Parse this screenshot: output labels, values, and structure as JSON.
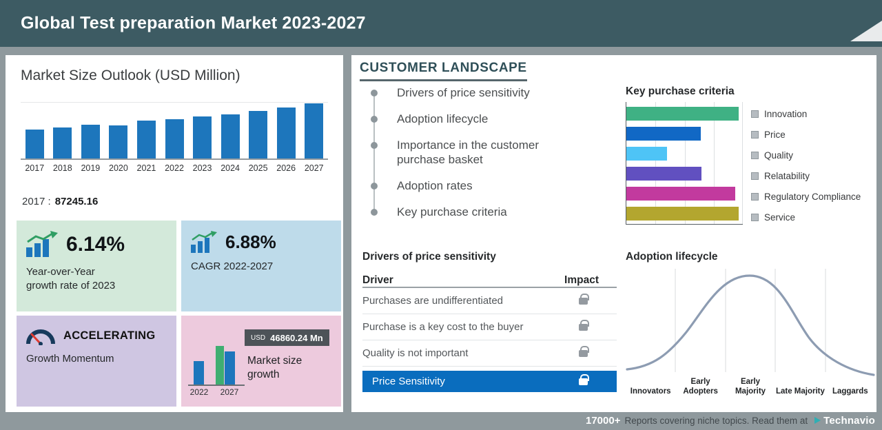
{
  "header": {
    "title": "Global Test preparation Market 2023-2027"
  },
  "colors": {
    "header_bg": "#3d5b63",
    "page_bg": "#8f999d",
    "bar_blue": "#1d76bc",
    "highlight_blue": "#0a6dbe",
    "yoy_card_bg": "#d3e9da",
    "cagr_card_bg": "#bedbea",
    "momentum_card_bg": "#cfc6e2",
    "growth_card_bg": "#edcadd",
    "curve": "#8d9cb2"
  },
  "icons": {
    "growth-chart-icon": "bar-chart-with-up-arrow",
    "cagr-chart-icon": "bar-chart-with-up-arrow",
    "speedometer-icon": "gauge-accelerating",
    "lock-icon": "padlock",
    "bullet-icon": "dot",
    "brand-mark-icon": "triangle-right"
  },
  "market_size": {
    "base_label": "2017 :",
    "base_value": "87245.16",
    "yoy_card": {
      "value": "6.14%",
      "line1": "Year-over-Year",
      "line2": "growth rate of 2023"
    },
    "cagr_card": {
      "value": "6.88%",
      "label": "CAGR 2022-2027"
    },
    "momentum_card": {
      "value": "ACCELERATING",
      "label": "Growth Momentum"
    },
    "growth_card": {
      "currency": "USD",
      "amount": "46860.24 Mn",
      "label_line1": "Market size",
      "label_line2": "growth"
    }
  },
  "customer_landscape": {
    "title": "CUSTOMER LANDSCAPE",
    "items": [
      "Drivers of price sensitivity",
      "Adoption lifecycle",
      "Importance in the customer purchase basket",
      "Adoption rates",
      "Key purchase criteria"
    ]
  },
  "price_sensitivity": {
    "title": "Drivers of price sensitivity",
    "col_driver": "Driver",
    "col_impact": "Impact",
    "rows": [
      "Purchases are undifferentiated",
      "Purchase is a key cost to the buyer",
      "Quality is not important"
    ],
    "highlight_row": "Price Sensitivity"
  },
  "footer": {
    "count": "17000+",
    "text": "Reports covering niche topics. Read them at",
    "brand": "Technavio"
  },
  "chart_data": [
    {
      "id": "market_size_outlook",
      "type": "bar",
      "title": "Market Size Outlook (USD Million)",
      "categories": [
        "2017",
        "2018",
        "2019",
        "2020",
        "2021",
        "2022",
        "2023",
        "2024",
        "2025",
        "2026",
        "2027"
      ],
      "values": [
        87245.16,
        93500,
        101800,
        99700,
        114200,
        118740,
        126030,
        133500,
        142500,
        153000,
        165600
      ],
      "ylabel": "USD Million",
      "bar_color": "#1d76bc",
      "labeled_point": {
        "category": "2017",
        "value": 87245.16
      }
    },
    {
      "id": "key_purchase_criteria",
      "type": "bar",
      "orientation": "horizontal",
      "title": "Key purchase criteria",
      "categories": [
        "Innovation",
        "Price",
        "Quality",
        "Relatability",
        "Regulatory Compliance",
        "Service"
      ],
      "values": [
        100,
        66,
        36,
        67,
        97,
        100
      ],
      "colors": [
        "#3fb184",
        "#1168c5",
        "#4ec4f6",
        "#6150c0",
        "#c23a9e",
        "#b3a62f"
      ],
      "legend_position": "right",
      "xlim": [
        0,
        100
      ]
    },
    {
      "id": "market_size_growth",
      "type": "bar",
      "title": "Market size growth",
      "categories": [
        "2022",
        "2027"
      ],
      "values": [
        118740,
        165600
      ],
      "annotation": "USD 46860.24 Mn"
    },
    {
      "id": "adoption_lifecycle",
      "type": "area",
      "shape": "bell_curve",
      "title": "Adoption lifecycle",
      "categories": [
        "Innovators",
        "Early Adopters",
        "Early Majority",
        "Late Majority",
        "Laggards"
      ]
    }
  ]
}
